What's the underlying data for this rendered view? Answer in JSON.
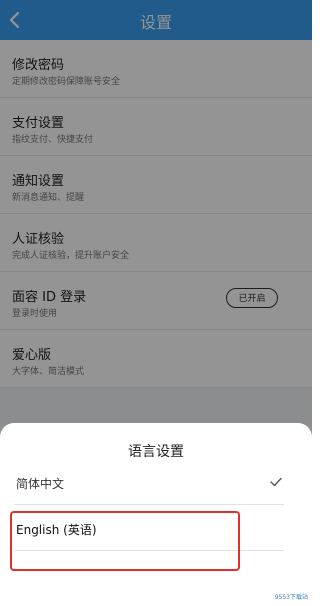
{
  "header": {
    "title": "设置",
    "back_icon": "chevron-left-icon",
    "bg_color": "#3a9df0"
  },
  "settings": [
    {
      "title": "修改密码",
      "subtitle": "定期修改密码保障账号安全"
    },
    {
      "title": "支付设置",
      "subtitle": "指纹支付、快捷支付"
    },
    {
      "title": "通知设置",
      "subtitle": "新消息通知、提醒"
    },
    {
      "title": "人证核验",
      "subtitle": "完成人证核验，提升账户安全"
    },
    {
      "title": "面容 ID 登录",
      "subtitle": "登录时使用",
      "button": "已开启"
    },
    {
      "title": "爱心版",
      "subtitle": "大字体、简洁模式"
    }
  ],
  "language_sheet": {
    "title": "语言设置",
    "options": [
      {
        "label": "简体中文",
        "selected": true
      },
      {
        "label": "English (英语)",
        "selected": false
      }
    ]
  },
  "highlight_color": "#e0302b",
  "watermark": "9553下载站"
}
